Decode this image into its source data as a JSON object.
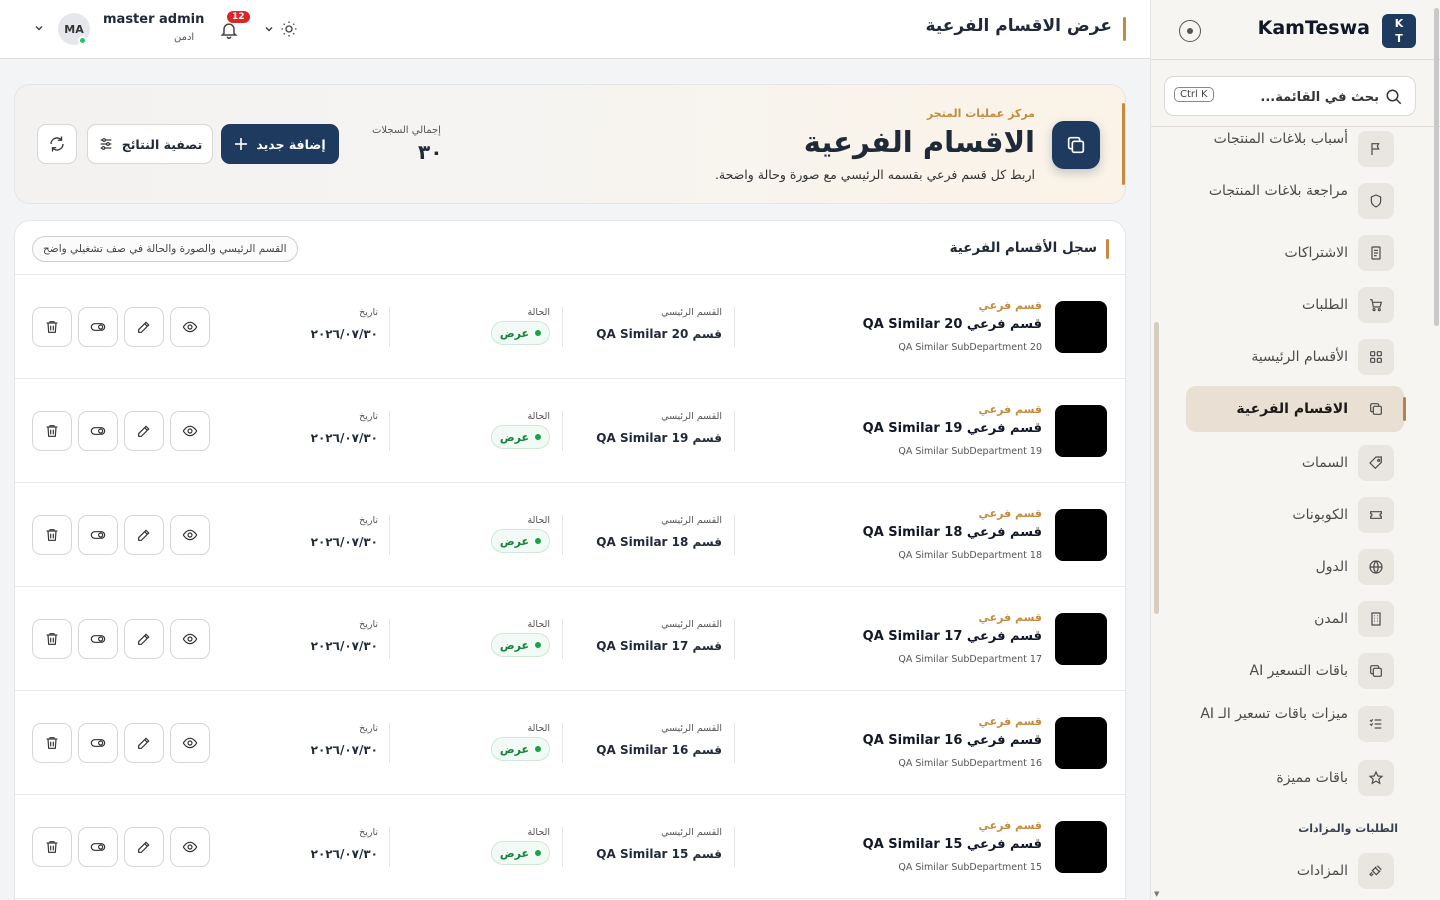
{
  "sidebar": {
    "brand_initials": "K\nT",
    "brand_name": "KamTeswa",
    "search_placeholder": "بحث في القائمة...",
    "search_shortcut": "Ctrl K",
    "items": [
      {
        "label": "أسباب بلاغات المنتجات",
        "icon": "flag-icon"
      },
      {
        "label": "مراجعة بلاغات المنتجات",
        "icon": "shield-icon"
      },
      {
        "label": "الاشتراكات",
        "icon": "receipt-icon"
      },
      {
        "label": "الطلبات",
        "icon": "cart-icon"
      },
      {
        "label": "الأقسام الرئيسية",
        "icon": "grid-icon"
      },
      {
        "label": "الاقسام الفرعية",
        "icon": "folders-icon",
        "active": true
      },
      {
        "label": "السمات",
        "icon": "tag-icon"
      },
      {
        "label": "الكوبونات",
        "icon": "ticket-icon"
      },
      {
        "label": "الدول",
        "icon": "globe-icon"
      },
      {
        "label": "المدن",
        "icon": "building-icon"
      },
      {
        "label": "باقات التسعير AI",
        "icon": "copy-icon"
      },
      {
        "label": "ميزات باقات تسعير الـ AI",
        "icon": "list-check-icon"
      },
      {
        "label": "باقات مميزة",
        "icon": "star-icon"
      },
      {
        "label": "المزادات",
        "icon": "gavel-icon"
      }
    ],
    "section_title": "الطلبات والمزادات"
  },
  "topbar": {
    "page_title": "عرض الاقسام الفرعية",
    "user_initials": "MA",
    "user_name": "master admin",
    "user_role": "ادمن",
    "notifications": "12"
  },
  "hero": {
    "eyebrow": "مركز عمليات المتجر",
    "title": "الاقسام الفرعية",
    "subtitle": "اربط كل قسم فرعي بقسمه الرئيسي مع صورة وحالة واضحة.",
    "stat_label": "إجمالي السجلات",
    "stat_value": "٣٠",
    "add_label": "إضافة جديد",
    "filter_label": "تصفية النتائج"
  },
  "table": {
    "title": "سجل الأقسام الفرعية",
    "chip": "القسم الرئيسي والصورة والحالة في صف تشغيلي واضح",
    "col_parent": "القسم الرئيسي",
    "col_status": "الحالة",
    "col_date": "تاريخ",
    "rows": [
      {
        "eyebrow": "قسم فرعي",
        "name": "قسم فرعي QA Similar 20",
        "slug": "QA Similar SubDepartment 20",
        "parent": "قسم QA Similar 20",
        "status": "عرض",
        "date": "٢٠٢٦/٠٧/٣٠"
      },
      {
        "eyebrow": "قسم فرعي",
        "name": "قسم فرعي QA Similar 19",
        "slug": "QA Similar SubDepartment 19",
        "parent": "قسم QA Similar 19",
        "status": "عرض",
        "date": "٢٠٢٦/٠٧/٣٠"
      },
      {
        "eyebrow": "قسم فرعي",
        "name": "قسم فرعي QA Similar 18",
        "slug": "QA Similar SubDepartment 18",
        "parent": "قسم QA Similar 18",
        "status": "عرض",
        "date": "٢٠٢٦/٠٧/٣٠"
      },
      {
        "eyebrow": "قسم فرعي",
        "name": "قسم فرعي QA Similar 17",
        "slug": "QA Similar SubDepartment 17",
        "parent": "قسم QA Similar 17",
        "status": "عرض",
        "date": "٢٠٢٦/٠٧/٣٠"
      },
      {
        "eyebrow": "قسم فرعي",
        "name": "قسم فرعي QA Similar 16",
        "slug": "QA Similar SubDepartment 16",
        "parent": "قسم QA Similar 16",
        "status": "عرض",
        "date": "٢٠٢٦/٠٧/٣٠"
      },
      {
        "eyebrow": "قسم فرعي",
        "name": "قسم فرعي QA Similar 15",
        "slug": "QA Similar SubDepartment 15",
        "parent": "قسم QA Similar 15",
        "status": "عرض",
        "date": "٢٠٢٦/٠٧/٣٠"
      }
    ]
  },
  "colors": {
    "primary": "#1e3a5f",
    "accent": "#c48a3f",
    "success": "#15803d",
    "danger": "#dc2626"
  }
}
